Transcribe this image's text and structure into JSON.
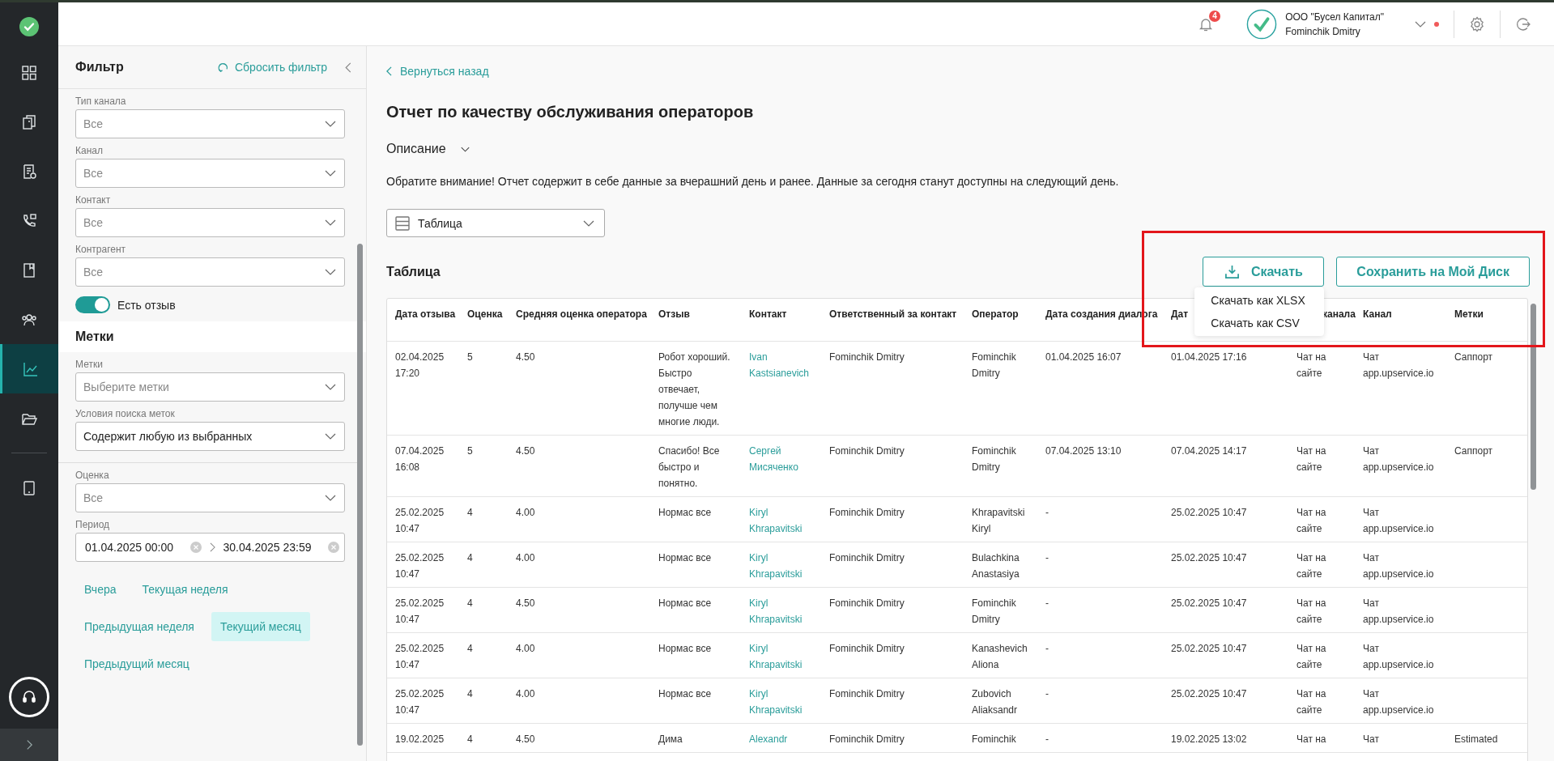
{
  "rail": {
    "items": [
      {
        "kind": "grid",
        "selected": false
      },
      {
        "kind": "clipboard",
        "selected": false
      },
      {
        "kind": "document",
        "selected": false
      },
      {
        "kind": "phone",
        "selected": false
      },
      {
        "kind": "book",
        "selected": false
      },
      {
        "kind": "people",
        "selected": false
      },
      {
        "kind": "chart",
        "selected": true
      },
      {
        "kind": "folder",
        "selected": false
      }
    ],
    "extra": [
      {
        "kind": "tablet",
        "selected": false
      }
    ]
  },
  "header": {
    "notifications": "4",
    "company": "ООО \"Бусел Капитал\"",
    "user": "Fominchik Dmitry",
    "online": true
  },
  "filter": {
    "title": "Фильтр",
    "reset": "Сбросить фильтр",
    "items": [
      {
        "kind": "select",
        "label": "Тип канала",
        "placeholder": "Все"
      },
      {
        "kind": "select",
        "label": "Канал",
        "placeholder": "Все"
      },
      {
        "kind": "select",
        "label": "Контакт",
        "placeholder": "Все"
      },
      {
        "kind": "select",
        "label": "Контрагент",
        "placeholder": "Все"
      },
      {
        "kind": "toggle",
        "label": "Есть отзыв",
        "on": true
      }
    ]
  },
  "tags": {
    "title": "Метки",
    "items": [
      {
        "kind": "select",
        "label": "Метки",
        "placeholder": "Выберите метки"
      },
      {
        "kind": "select",
        "label": "Условия поиска меток",
        "value": "Содержит любую из выбранных"
      }
    ]
  },
  "rating": {
    "label": "Оценка",
    "placeholder": "Все"
  },
  "period": {
    "label": "Период",
    "from": "01.04.2025 00:00",
    "to": "30.04.2025 23:59"
  },
  "presets": [
    {
      "label": "Вчера",
      "selected": false
    },
    {
      "label": "Текущая неделя",
      "selected": false
    },
    {
      "label": "Предыдущая неделя",
      "selected": false
    },
    {
      "label": "Текущий месяц",
      "selected": true
    },
    {
      "label": "Предыдущий месяц",
      "selected": false
    }
  ],
  "back": "Вернуться назад",
  "title": "Отчет по качеству обслуживания операторов",
  "description": {
    "label": "Описание",
    "expanded": false
  },
  "notice": "Обратите внимание! Отчет содержит в себе данные за вчерашний день и ранее. Данные за сегодня станут доступны на следующий день.",
  "view_select": "Таблица",
  "table_title": "Таблица",
  "download": "Скачать",
  "download_menu": [
    "Скачать как XLSX",
    "Скачать как CSV"
  ],
  "save": "Сохранить на Мой Диск",
  "annotation_frame": true,
  "table": {
    "columns": [
      {
        "label": "Дата отзыва",
        "kind": "text"
      },
      {
        "label": "Оценка",
        "kind": "text"
      },
      {
        "label": "Средняя оценка оператора",
        "kind": "text"
      },
      {
        "label": "Отзыв",
        "kind": "text"
      },
      {
        "label": "Контакт",
        "kind": "link"
      },
      {
        "label": "Ответственный за контакт",
        "kind": "text"
      },
      {
        "label": "Оператор",
        "kind": "text"
      },
      {
        "label": "Дата создания диалога",
        "kind": "text"
      },
      {
        "label": "Дат",
        "kind": "text"
      },
      {
        "label": "канала",
        "kind": "text"
      },
      {
        "label": "Канал",
        "kind": "text"
      },
      {
        "label": "Метки",
        "kind": "text"
      }
    ],
    "rows": [
      [
        "02.04.2025 17:20",
        "5",
        "4.50",
        "Робот хороший. Быстро отвечает, получше чем многие люди.",
        "Ivan Kastsianevich",
        "Fominchik Dmitry",
        "Fominchik Dmitry",
        "01.04.2025 16:07",
        "01.04.2025 17:16",
        "Чат на сайте",
        "Чат app.upservice.io",
        "Саппорт"
      ],
      [
        "07.04.2025 16:08",
        "5",
        "4.50",
        "Спасибо! Все быстро и понятно.",
        "Сергей Мисяченко",
        "Fominchik Dmitry",
        "Fominchik Dmitry",
        "07.04.2025 13:10",
        "07.04.2025 14:17",
        "Чат на сайте",
        "Чат app.upservice.io",
        "Саппорт"
      ],
      [
        "25.02.2025 10:47",
        "4",
        "4.00",
        "Нормас все",
        "Kiryl Khrapavitski",
        "Fominchik Dmitry",
        "Khrapavitski Kiryl",
        "-",
        "25.02.2025 10:47",
        "Чат на сайте",
        "Чат app.upservice.io",
        ""
      ],
      [
        "25.02.2025 10:47",
        "4",
        "4.00",
        "Нормас все",
        "Kiryl Khrapavitski",
        "Fominchik Dmitry",
        "Bulachkina Anastasiya",
        "-",
        "25.02.2025 10:47",
        "Чат на сайте",
        "Чат app.upservice.io",
        ""
      ],
      [
        "25.02.2025 10:47",
        "4",
        "4.50",
        "Нормас все",
        "Kiryl Khrapavitski",
        "Fominchik Dmitry",
        "Fominchik Dmitry",
        "-",
        "25.02.2025 10:47",
        "Чат на сайте",
        "Чат app.upservice.io",
        ""
      ],
      [
        "25.02.2025 10:47",
        "4",
        "4.00",
        "Нормас все",
        "Kiryl Khrapavitski",
        "Fominchik Dmitry",
        "Kanashevich Aliona",
        "-",
        "25.02.2025 10:47",
        "Чат на сайте",
        "Чат app.upservice.io",
        ""
      ],
      [
        "25.02.2025 10:47",
        "4",
        "4.00",
        "Нормас все",
        "Kiryl Khrapavitski",
        "Fominchik Dmitry",
        "Zubovich Aliaksandr",
        "-",
        "25.02.2025 10:47",
        "Чат на сайте",
        "Чат app.upservice.io",
        ""
      ],
      [
        "19.02.2025",
        "4",
        "4.50",
        "Дима",
        "Alexandr",
        "Fominchik Dmitry",
        "Fominchik",
        "-",
        "19.02.2025 13:02",
        "Чат на",
        "Чат",
        "Estimated"
      ]
    ]
  }
}
